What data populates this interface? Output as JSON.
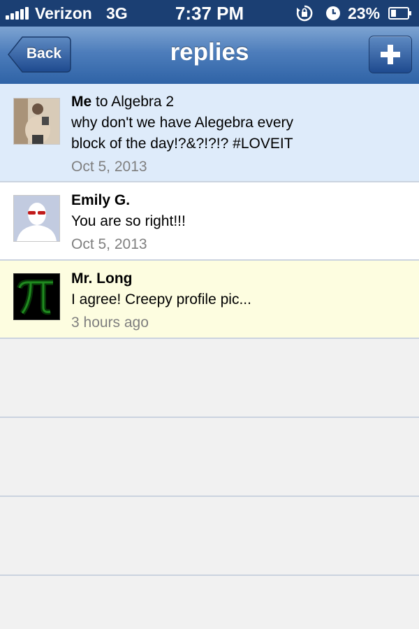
{
  "status_bar": {
    "carrier": "Verizon",
    "network": "3G",
    "time": "7:37 PM",
    "battery_percent": "23%",
    "icons": [
      "signal-icon",
      "rotation-lock-icon",
      "alarm-icon",
      "battery-icon"
    ]
  },
  "nav": {
    "back_label": "Back",
    "title": "replies",
    "add_icon": "plus-icon"
  },
  "replies": [
    {
      "author": "Me",
      "target": " to Algebra 2",
      "message": "why don't we have Alegebra every block of the day!?&?!?!? #LOVEIT",
      "timestamp": "Oct 5, 2013",
      "background": "#deebfa"
    },
    {
      "author": "Emily G.",
      "target": "",
      "message": "You are so right!!!",
      "timestamp": "Oct 5, 2013",
      "background": "#ffffff"
    },
    {
      "author": "Mr. Long",
      "target": "",
      "message": "I agree!  Creepy profile pic...",
      "timestamp": "3 hours ago",
      "background": "#fdfde0"
    }
  ],
  "colors": {
    "status_bar": "#1b3f73",
    "nav_bar": "#4d7dbb",
    "row_divider": "#cbd3df",
    "timestamp": "#7f7f7f"
  }
}
